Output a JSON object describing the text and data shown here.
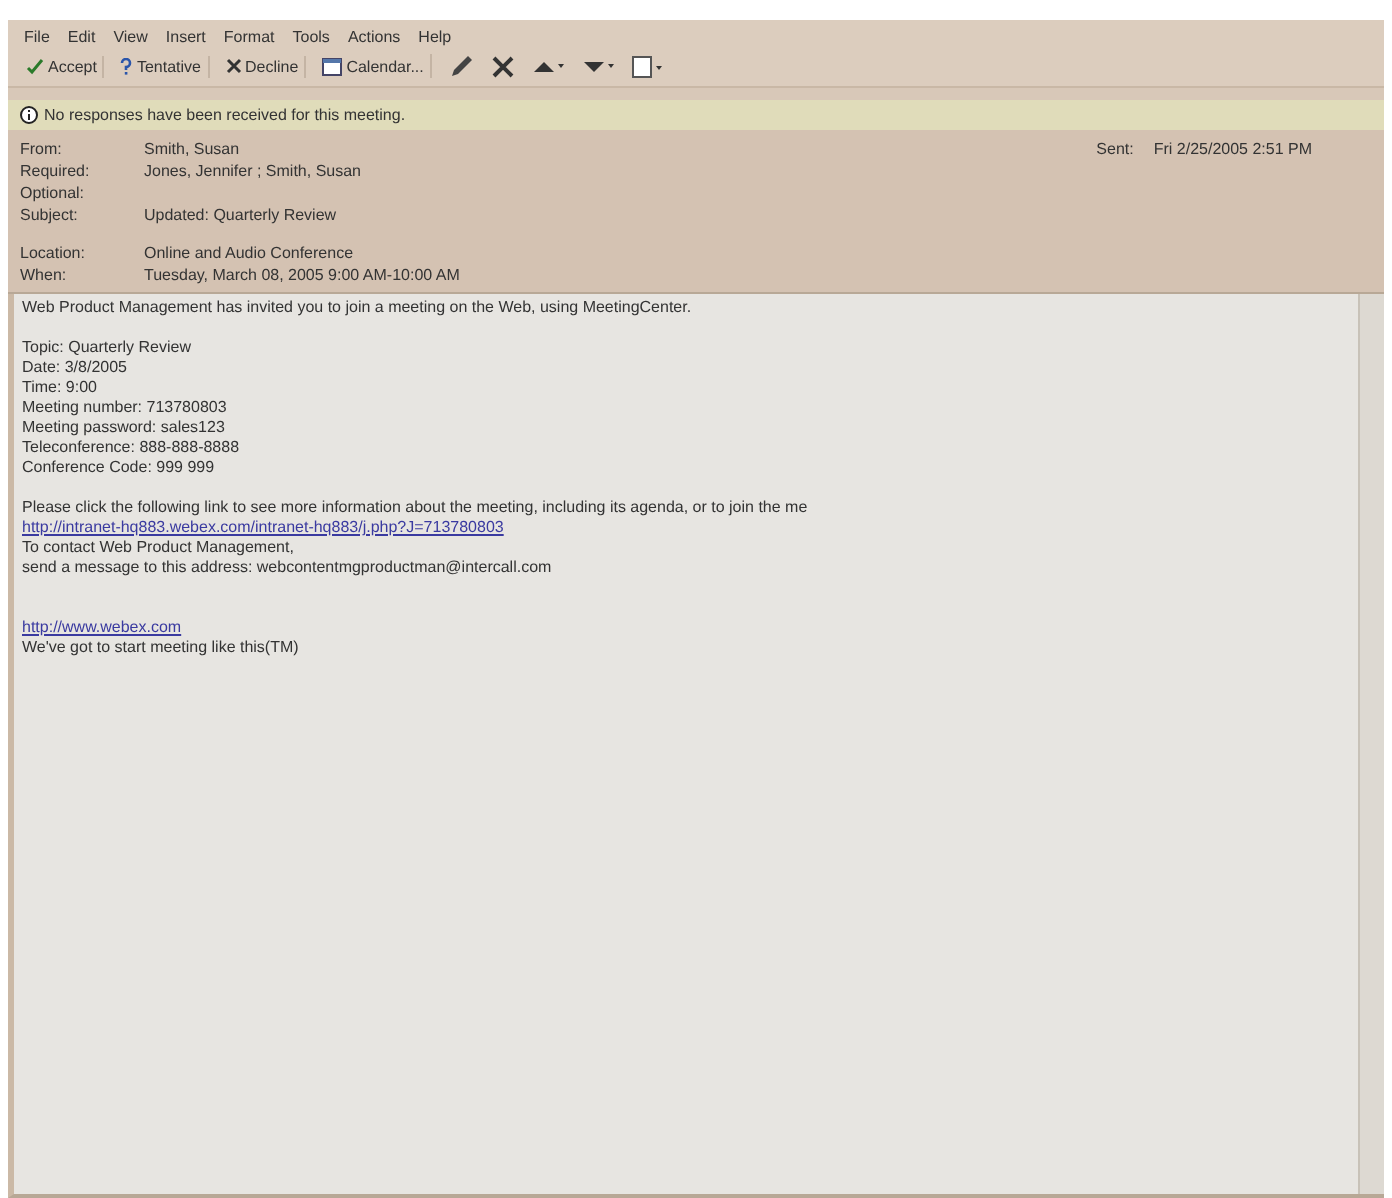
{
  "menu": [
    "File",
    "Edit",
    "View",
    "Insert",
    "Format",
    "Tools",
    "Actions",
    "Help"
  ],
  "toolbar": [
    {
      "kind": "check",
      "label": "Accept"
    },
    {
      "kind": "question",
      "label": "Tentative"
    },
    {
      "kind": "cross",
      "label": "Decline"
    },
    {
      "kind": "calendar",
      "label": "Calendar..."
    }
  ],
  "info_bar": "No responses have been received for this meeting.",
  "header": [
    {
      "label": "From:",
      "value": "Smith, Susan"
    },
    {
      "label": "Required:",
      "value": "Jones, Jennifer ; Smith, Susan"
    },
    {
      "label": "Optional:"
    },
    {
      "label": "Subject:",
      "value": "Updated: Quarterly Review"
    },
    {
      "label": "Location:",
      "value": "Online and Audio Conference"
    },
    {
      "label": "When:",
      "value": "Tuesday, March 08, 2005 9:00 AM-10:00 AM"
    }
  ],
  "sent": {
    "label": "Sent:",
    "value": "Fri 2/25/2005 2:51 PM"
  },
  "body": [
    {
      "kind": "text",
      "text": "Web Product Management has invited you to join a meeting on the Web, using MeetingCenter."
    },
    {
      "kind": "gap"
    },
    {
      "kind": "text",
      "text": "Topic: Quarterly Review"
    },
    {
      "kind": "text",
      "text": "Date: 3/8/2005"
    },
    {
      "kind": "text",
      "text": "Time: 9:00"
    },
    {
      "kind": "text",
      "text": "Meeting number: 713780803"
    },
    {
      "kind": "text",
      "text": "Meeting password: sales123"
    },
    {
      "kind": "text",
      "text": "Teleconference: 888-888-8888"
    },
    {
      "kind": "text",
      "text": "Conference Code: 999 999"
    },
    {
      "kind": "gap"
    },
    {
      "kind": "text",
      "text": "Please click the following link to see more information about the meeting, including its agenda, or to join the me"
    },
    {
      "kind": "link",
      "text": "http://intranet-hq883.webex.com/intranet-hq883/j.php?J=713780803"
    },
    {
      "kind": "text",
      "text": "To contact Web Product Management,"
    },
    {
      "kind": "text",
      "text": "send a message to this address: webcontentmgproductman@intercall.com"
    },
    {
      "kind": "gap"
    },
    {
      "kind": "gap"
    },
    {
      "kind": "link",
      "text": "http://www.webex.com"
    },
    {
      "kind": "text",
      "text": "We've got to start meeting like this(TM)"
    }
  ]
}
